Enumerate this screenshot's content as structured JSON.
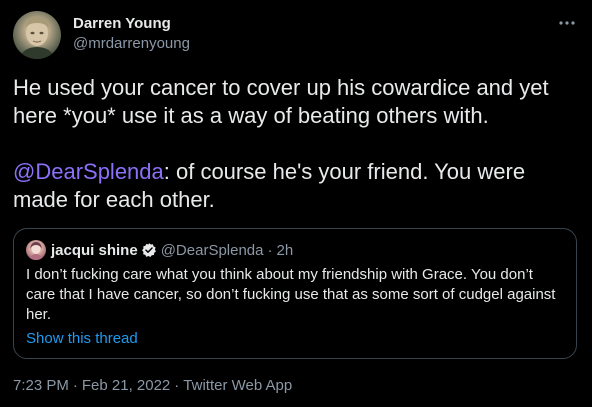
{
  "author": {
    "display_name": "Darren Young",
    "handle": "@mrdarrenyoung",
    "avatar_icon": "profile-photo"
  },
  "more_icon": "more-options-icon",
  "tweet": {
    "line1": "He used your cancer to cover up his cowardice and yet here *you* use it as a way of beating others with.",
    "mention": "@DearSplenda",
    "line2_rest": ": of course he's your friend. You were made for each other."
  },
  "quoted": {
    "display_name": "jacqui shine",
    "verified": true,
    "handle": "@DearSplenda",
    "separator": "·",
    "time": "2h",
    "text": "I don’t fucking care what you think about my friendship with Grace. You don’t care that I have cancer, so don’t fucking use that as some sort of cudgel against her.",
    "show_thread": "Show this thread"
  },
  "meta": {
    "time": "7:23 PM",
    "separator": "·",
    "date": "Feb 21, 2022",
    "source": "Twitter Web App"
  },
  "colors": {
    "background": "#000000",
    "text": "#e7e9ea",
    "secondary": "#8b98a5",
    "link": "#1d9bf0",
    "mention": "#8b70f8",
    "border": "#38444d"
  }
}
